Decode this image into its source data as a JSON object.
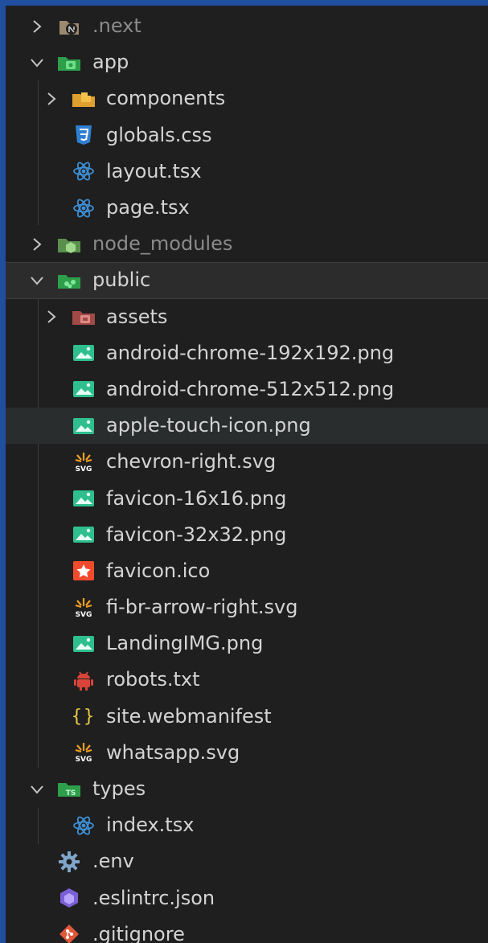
{
  "explorer": {
    "items": [
      {
        "label": ".next",
        "kind": "folder",
        "state": "collapsed",
        "icon": "next-folder-icon",
        "dim": true
      },
      {
        "label": "app",
        "kind": "folder",
        "state": "expanded",
        "icon": "app-folder-icon"
      },
      {
        "label": "components",
        "kind": "folder",
        "state": "collapsed",
        "icon": "components-folder-icon"
      },
      {
        "label": "globals.css",
        "kind": "file",
        "icon": "css-file-icon"
      },
      {
        "label": "layout.tsx",
        "kind": "file",
        "icon": "react-file-icon"
      },
      {
        "label": "page.tsx",
        "kind": "file",
        "icon": "react-file-icon"
      },
      {
        "label": "node_modules",
        "kind": "folder",
        "state": "collapsed",
        "icon": "node-modules-folder-icon",
        "dim": true
      },
      {
        "label": "public",
        "kind": "folder",
        "state": "expanded",
        "icon": "public-folder-icon",
        "selected": true
      },
      {
        "label": "assets",
        "kind": "folder",
        "state": "collapsed",
        "icon": "assets-folder-icon"
      },
      {
        "label": "android-chrome-192x192.png",
        "kind": "file",
        "icon": "image-file-icon"
      },
      {
        "label": "android-chrome-512x512.png",
        "kind": "file",
        "icon": "image-file-icon"
      },
      {
        "label": "apple-touch-icon.png",
        "kind": "file",
        "icon": "image-file-icon",
        "hovered": true
      },
      {
        "label": "chevron-right.svg",
        "kind": "file",
        "icon": "svg-file-icon"
      },
      {
        "label": "favicon-16x16.png",
        "kind": "file",
        "icon": "image-file-icon"
      },
      {
        "label": "favicon-32x32.png",
        "kind": "file",
        "icon": "image-file-icon"
      },
      {
        "label": "favicon.ico",
        "kind": "file",
        "icon": "favicon-file-icon"
      },
      {
        "label": "fi-br-arrow-right.svg",
        "kind": "file",
        "icon": "svg-file-icon"
      },
      {
        "label": "LandingIMG.png",
        "kind": "file",
        "icon": "image-file-icon"
      },
      {
        "label": "robots.txt",
        "kind": "file",
        "icon": "robots-file-icon"
      },
      {
        "label": "site.webmanifest",
        "kind": "file",
        "icon": "json-braces-icon"
      },
      {
        "label": "whatsapp.svg",
        "kind": "file",
        "icon": "svg-file-icon"
      },
      {
        "label": "types",
        "kind": "folder",
        "state": "expanded",
        "icon": "types-folder-icon"
      },
      {
        "label": "index.tsx",
        "kind": "file",
        "icon": "react-file-icon"
      },
      {
        "label": ".env",
        "kind": "file",
        "icon": "gear-icon"
      },
      {
        "label": ".eslintrc.json",
        "kind": "file",
        "icon": "eslint-file-icon"
      },
      {
        "label": ".gitignore",
        "kind": "file",
        "icon": "git-file-icon"
      }
    ]
  },
  "colors": {
    "accent_border": "#1f4f9e",
    "background": "#1f1f1f",
    "text": "#d4d4d4",
    "dim_text": "#8b8b8b",
    "folder_green": "#3fb950",
    "image_green": "#2fbf8f",
    "react_blue": "#3d8fd6",
    "css_blue": "#2f7fd1",
    "svg_orange": "#f0a020",
    "favicon_red": "#f24a2d",
    "robots_red": "#d9453a",
    "json_yellow": "#e8c84a",
    "eslint_purple": "#7b5fd6",
    "git_red": "#e0573a",
    "gear_blue": "#7fa6c9"
  }
}
